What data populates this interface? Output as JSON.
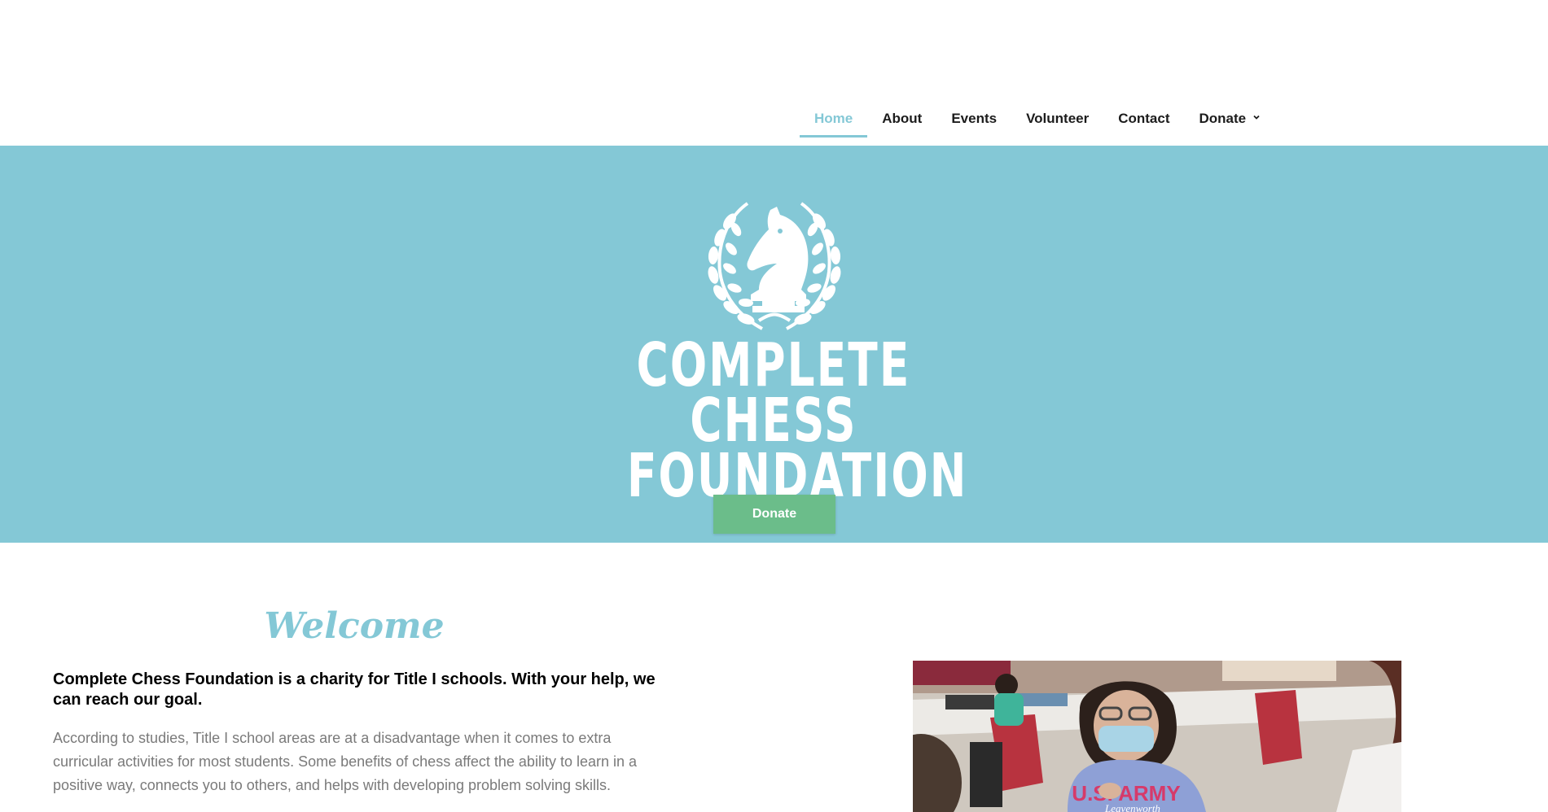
{
  "nav": {
    "items": [
      {
        "label": "Home",
        "active": true
      },
      {
        "label": "About"
      },
      {
        "label": "Events"
      },
      {
        "label": "Volunteer"
      },
      {
        "label": "Contact"
      },
      {
        "label": "Donate",
        "dropdown": true
      }
    ]
  },
  "hero": {
    "logo_line1": "COMPLETE CHESS",
    "logo_line2": "FOUNDATION",
    "donate_label": "Donate",
    "colors": {
      "background": "#84c8d6",
      "button": "#6bbd8a"
    }
  },
  "welcome": {
    "title": "Welcome",
    "lead": "Complete Chess Foundation is a charity for Title I schools. With your help, we can reach our goal.",
    "body": "According to studies, Title I school areas are at a disadvantage when it comes to extra curricular activities for most students. Some benefits of chess affect the ability to learn in a positive way, connects you to others, and helps with developing problem solving skills."
  },
  "photo": {
    "shirt_text": "U.S. ARMY",
    "shirt_subtext": "Leavenworth"
  }
}
